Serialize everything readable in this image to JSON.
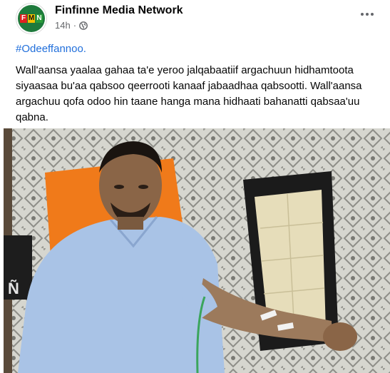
{
  "post": {
    "page_name": "Finfinne Media Network",
    "avatar_letters": [
      "F",
      "M",
      "N"
    ],
    "timestamp": "14h",
    "dot": "·",
    "hashtag": "#Odeeffannoo.",
    "body": "Wall'aansa yaalaa gahaa ta'e yeroo jalqabaatiif argachuun hidhamtoota siyaasaa bu'aa qabsoo qeerrooti kanaaf jabaadhaa qabsootti. Wall'aansa argachuu qofa odoo hin taane hanga mana hidhaati bahanatti qabsaa'uu qabna.",
    "photo_side_logo": "Ñ"
  },
  "colors": {
    "link": "#216fdb",
    "secondary_text": "#65676b",
    "chair_orange": "#f07a1a",
    "shirt_blue": "#a9c3e6"
  },
  "icons": [
    "globe-icon",
    "more-options-icon"
  ]
}
